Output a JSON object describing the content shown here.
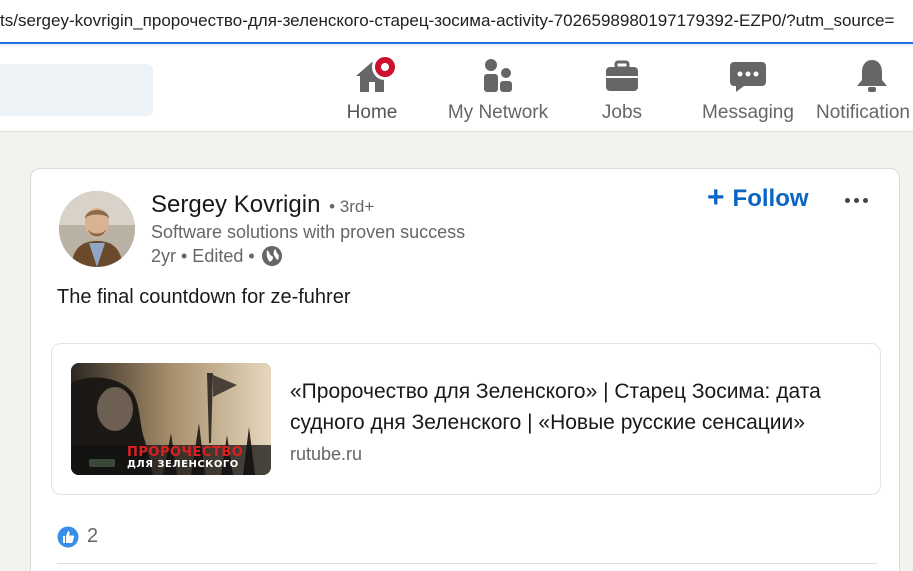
{
  "browser": {
    "url": "ts/sergey-kovrigin_пророчество-для-зеленского-старец-зосима-activity-7026598980197179392-EZP0/?utm_source="
  },
  "nav": {
    "items": [
      {
        "label": "Home",
        "icon": "home-icon"
      },
      {
        "label": "My Network",
        "icon": "people-icon"
      },
      {
        "label": "Jobs",
        "icon": "briefcase-icon"
      },
      {
        "label": "Messaging",
        "icon": "chat-icon"
      },
      {
        "label": "Notification",
        "icon": "bell-icon"
      }
    ]
  },
  "post": {
    "author": {
      "name": "Sergey Kovrigin",
      "degree": "• 3rd+",
      "headline": "Software solutions with proven success",
      "time": "2yr • Edited •"
    },
    "follow_label": "Follow",
    "text": "The final countdown for ze-fuhrer",
    "link": {
      "title": "«Пророчество для Зеленского» | Старец Зосима: дата судного дня Зеленского | «Новые русские сенсации»",
      "domain": "rutube.ru",
      "thumb_caption_1": "ПРОРОЧЕСТВО",
      "thumb_caption_2": "ДЛЯ ЗЕЛЕНСКОГО"
    },
    "reaction_count": "2"
  },
  "colors": {
    "accent": "#0a66c2",
    "badge": "#cb112d",
    "background": "#f4f2ee"
  }
}
